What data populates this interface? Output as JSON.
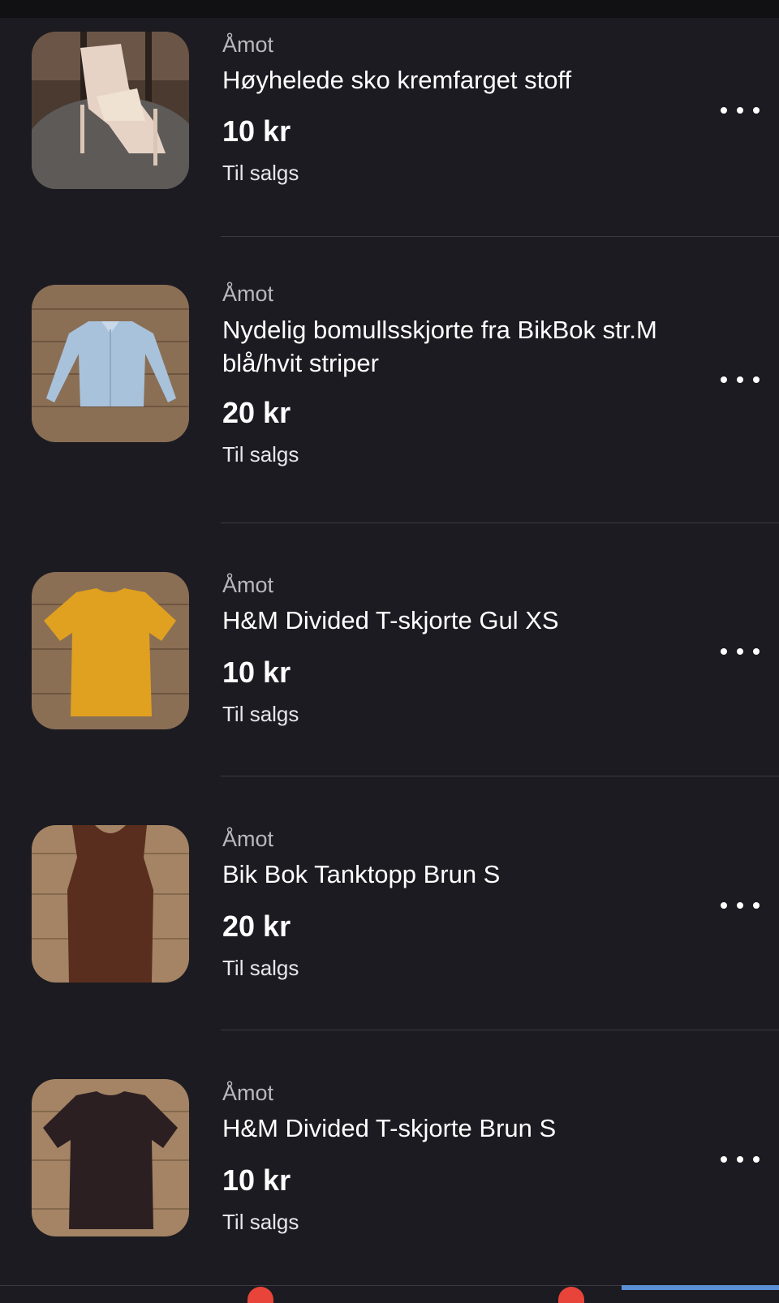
{
  "listings": [
    {
      "location": "Åmot",
      "title": "Høyhelede sko kremfarget stoff",
      "price": "10 kr",
      "status": "Til salgs",
      "image": "heeled-shoes-image"
    },
    {
      "location": "Åmot",
      "title": "Nydelig bomullsskjorte fra BikBok str.M blå/hvit striper",
      "price": "20 kr",
      "status": "Til salgs",
      "image": "striped-shirt-image"
    },
    {
      "location": "Åmot",
      "title": "H&M Divided T-skjorte Gul XS",
      "price": "10 kr",
      "status": "Til salgs",
      "image": "yellow-tshirt-image"
    },
    {
      "location": "Åmot",
      "title": "Bik Bok Tanktopp Brun S",
      "price": "20 kr",
      "status": "Til salgs",
      "image": "brown-tanktop-image"
    },
    {
      "location": "Åmot",
      "title": "H&M Divided T-skjorte Brun S",
      "price": "10 kr",
      "status": "Til salgs",
      "image": "brown-tshirt-image"
    }
  ],
  "colors": {
    "background": "#1c1b21",
    "text_primary": "#ffffff",
    "text_secondary": "#b9b8bd",
    "divider": "#3b3a40",
    "tab_accent": "#5b8fd6",
    "badge": "#e8443a"
  },
  "icons": {
    "more": "more-horizontal-icon"
  }
}
